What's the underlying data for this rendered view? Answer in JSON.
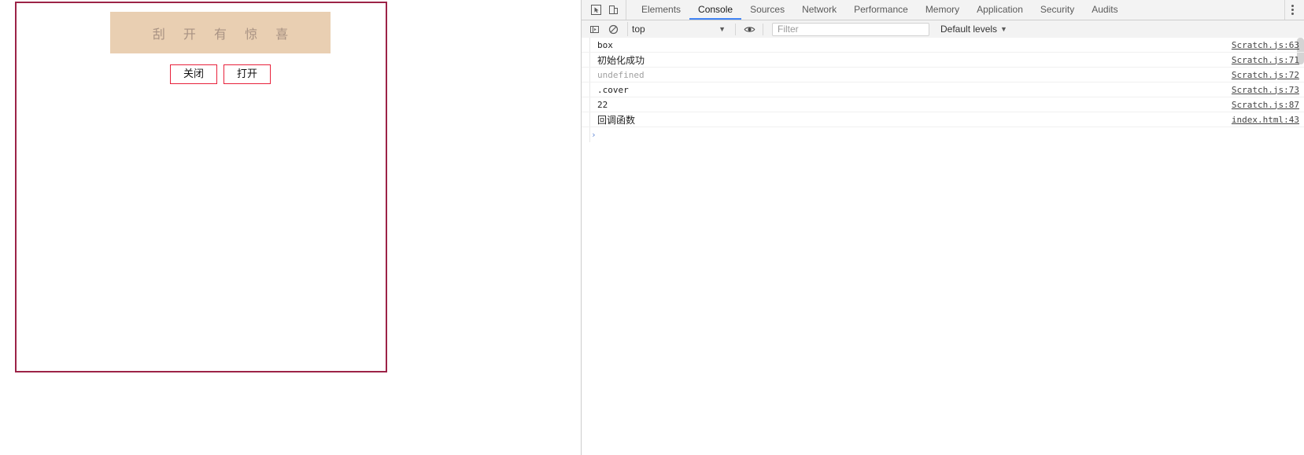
{
  "page": {
    "scratch_card": {
      "cover_text": "刮 开 有 惊 喜",
      "cover_color": "#e9cfb2",
      "cover_text_color": "#a89283",
      "container_border_color": "#9c2347",
      "buttons": [
        {
          "label": "关闭",
          "name": "close-button"
        },
        {
          "label": "打开",
          "name": "open-button"
        }
      ],
      "button_border_color": "#e8213b"
    }
  },
  "devtools": {
    "tabs": [
      {
        "label": "Elements",
        "active": false
      },
      {
        "label": "Console",
        "active": true
      },
      {
        "label": "Sources",
        "active": false
      },
      {
        "label": "Network",
        "active": false
      },
      {
        "label": "Performance",
        "active": false
      },
      {
        "label": "Memory",
        "active": false
      },
      {
        "label": "Application",
        "active": false
      },
      {
        "label": "Security",
        "active": false
      },
      {
        "label": "Audits",
        "active": false
      }
    ],
    "active_tab_color": "#4285f4",
    "icons": {
      "inspect": "inspect-element-icon",
      "device": "device-toolbar-icon",
      "sidebar": "console-sidebar-icon",
      "clear": "clear-console-icon",
      "eye": "live-expression-eye-icon",
      "kebab": "more-options-icon"
    },
    "console_toolbar": {
      "context_value": "top",
      "filter_placeholder": "Filter",
      "filter_value": "",
      "levels_label": "Default levels"
    },
    "console_messages": [
      {
        "text": "box",
        "style": "mono",
        "source": "Scratch.js:63"
      },
      {
        "text": "初始化成功",
        "style": "cjk",
        "source": "Scratch.js:71"
      },
      {
        "text": "undefined",
        "style": "dim",
        "source": "Scratch.js:72"
      },
      {
        "text": ".cover",
        "style": "mono",
        "source": "Scratch.js:73"
      },
      {
        "text": "22",
        "style": "mono",
        "source": "Scratch.js:87"
      },
      {
        "text": "回调函数",
        "style": "cjk",
        "source": "index.html:43"
      }
    ],
    "prompt": {
      "arrow": "›",
      "value": "",
      "placeholder": ""
    }
  }
}
